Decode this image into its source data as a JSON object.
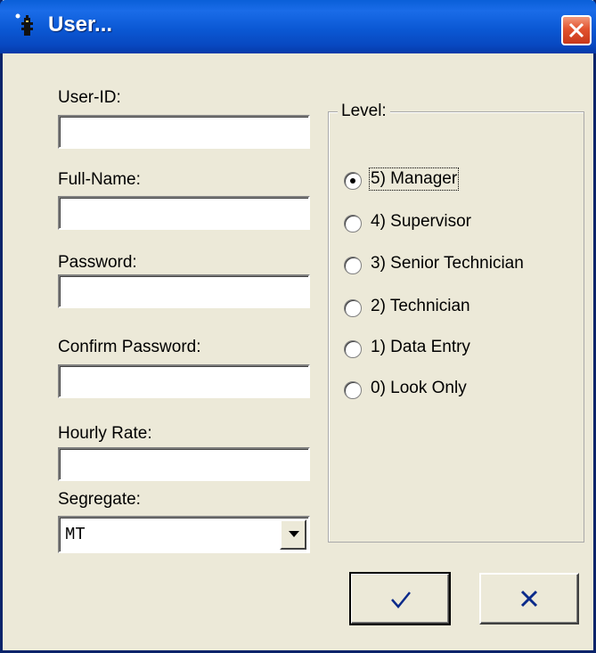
{
  "window": {
    "title": "User...",
    "colors": {
      "titlebar": "#0A5FD8",
      "background": "#ECE9D8",
      "close": "#E2532F"
    }
  },
  "form": {
    "user_id_label": "User-ID:",
    "user_id_value": "",
    "full_name_label": "Full-Name:",
    "full_name_value": "",
    "password_label": "Password:",
    "password_value": "",
    "confirm_password_label": "Confirm Password:",
    "confirm_password_value": "",
    "hourly_rate_label": "Hourly Rate:",
    "hourly_rate_value": "",
    "segregate_label": "Segregate:",
    "segregate_value": "MT"
  },
  "level": {
    "title": "Level:",
    "options": [
      {
        "label": "5) Manager",
        "selected": true
      },
      {
        "label": "4) Supervisor",
        "selected": false
      },
      {
        "label": "3) Senior Technician",
        "selected": false
      },
      {
        "label": "2) Technician",
        "selected": false
      },
      {
        "label": "1) Data Entry",
        "selected": false
      },
      {
        "label": "0) Look Only",
        "selected": false
      }
    ]
  },
  "buttons": {
    "ok_icon": "checkmark-icon",
    "cancel_icon": "x-icon"
  }
}
